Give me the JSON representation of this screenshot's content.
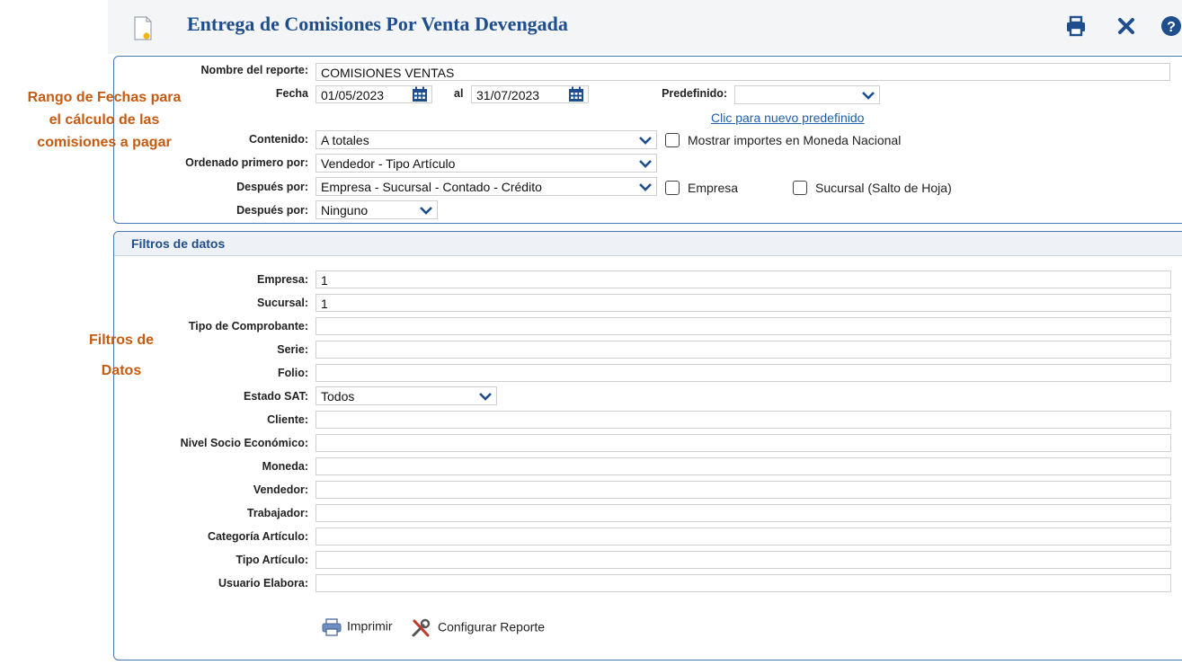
{
  "header": {
    "title": "Entrega de Comisiones Por Venta Devengada",
    "icons": [
      "document-icon",
      "printer-icon",
      "close-icon",
      "help-icon"
    ]
  },
  "report": {
    "nombre_label": "Nombre del reporte:",
    "nombre_value": "COMISIONES VENTAS",
    "fecha_label": "Fecha",
    "fecha_desde": "01/05/2023",
    "al_label": "al",
    "fecha_hasta": "31/07/2023",
    "predefinido_label": "Predefinido:",
    "predefinido_value": "",
    "nuevo_predefinido_link": "Clic para nuevo predefinido",
    "contenido_label": "Contenido:",
    "contenido_value": "A totales",
    "moneda_nacional_label": "Mostrar importes en Moneda Nacional",
    "ordenado_label": "Ordenado primero por:",
    "ordenado_value": "Vendedor - Tipo Artículo",
    "despues1_label": "Después por:",
    "despues1_value": "Empresa - Sucursal - Contado - Crédito",
    "empresa_check_label": "Empresa",
    "sucursal_check_label": "Sucursal (Salto de Hoja)",
    "despues2_label": "Después por:",
    "despues2_value": "Ninguno"
  },
  "annotations": {
    "rango_line1": "Rango de Fechas para",
    "rango_line2": "el cálculo de las",
    "rango_line3": "comisiones a pagar",
    "filtros_line1": "Filtros de",
    "filtros_line2": "Datos",
    "color": "#c55a11"
  },
  "filters": {
    "title": "Filtros de datos",
    "empresa_label": "Empresa:",
    "empresa_value": "1",
    "sucursal_label": "Sucursal:",
    "sucursal_value": "1",
    "tipo_comprobante_label": "Tipo de Comprobante:",
    "serie_label": "Serie:",
    "folio_label": "Folio:",
    "estado_sat_label": "Estado SAT:",
    "estado_sat_value": "Todos",
    "cliente_label": "Cliente:",
    "nivel_label": "Nivel Socio Económico:",
    "moneda_label": "Moneda:",
    "vendedor_label": "Vendedor:",
    "trabajador_label": "Trabajador:",
    "categoria_label": "Categoría Artículo:",
    "tipo_articulo_label": "Tipo Artículo:",
    "usuario_label": "Usuario Elabora:"
  },
  "actions": {
    "imprimir": "Imprimir",
    "configurar": "Configurar Reporte"
  },
  "colors": {
    "title": "#1f4e8c",
    "panel_border": "#4a77b8",
    "link": "#1f5fa8",
    "calendar": "#1f4e8c"
  }
}
